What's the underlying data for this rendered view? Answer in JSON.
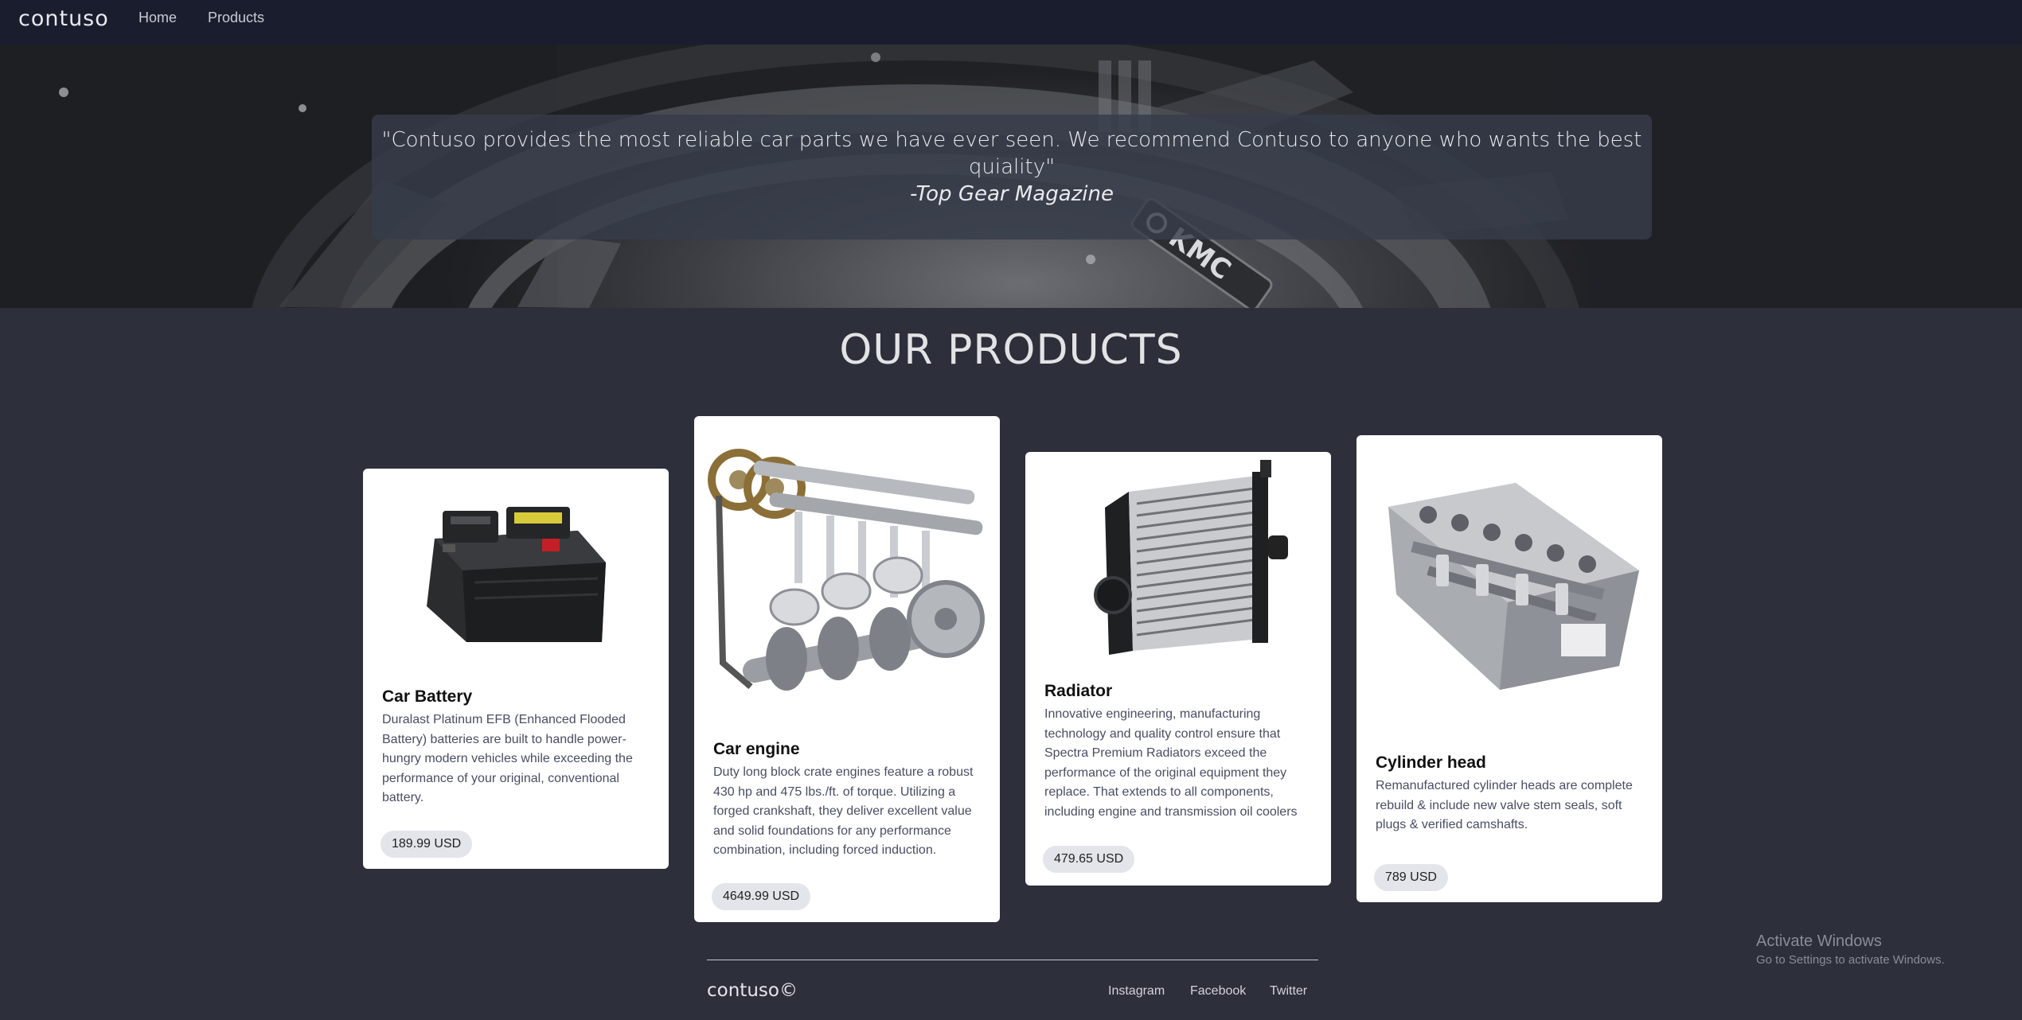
{
  "navbar": {
    "brand": "contuso",
    "links": [
      "Home",
      "Products"
    ]
  },
  "hero": {
    "quote": "\"Contuso provides the most reliable car parts we have ever seen. We recommend Contuso to anyone who wants the best quiality\"",
    "author": "-Top Gear Magazine",
    "wheel_lettering": "KMC"
  },
  "section": {
    "title": "OUR PRODUCTS"
  },
  "products": [
    {
      "name": "Car Battery",
      "description": "Duralast Platinum EFB (Enhanced Flooded Battery) batteries are built to handle power-hungry modern vehicles while exceeding the performance of your original, conventional battery.",
      "price": "189.99 USD",
      "image": "car-battery-image"
    },
    {
      "name": "Car engine",
      "description": "Duty long block crate engines feature a robust 430 hp and 475 lbs./ft. of torque. Utilizing a forged crankshaft, they deliver excellent value and solid foundations for any performance combination, including forced induction.",
      "price": "4649.99 USD",
      "image": "car-engine-image"
    },
    {
      "name": "Radiator",
      "description": "Innovative engineering, manufacturing technology and quality control ensure that Spectra Premium Radiators exceed the performance of the original equipment they replace. That extends to all components, including engine and transmission oil coolers",
      "price": "479.65 USD",
      "image": "radiator-image"
    },
    {
      "name": "Cylinder head",
      "description": "Remanufactured cylinder heads are complete rebuild & include new valve stem seals, soft plugs & verified camshafts.",
      "price": "789 USD",
      "image": "cylinder-head-image"
    }
  ],
  "footer": {
    "brand": "contuso©",
    "links": [
      "Instagram",
      "Facebook",
      "Twitter"
    ]
  },
  "watermark": {
    "title": "Activate Windows",
    "subtitle": "Go to Settings to activate Windows."
  },
  "colors": {
    "navbar_bg": "#1a1d2e",
    "page_bg": "#2d2f3b",
    "card_bg": "#ffffff",
    "price_badge_bg": "#e4e5ea"
  }
}
